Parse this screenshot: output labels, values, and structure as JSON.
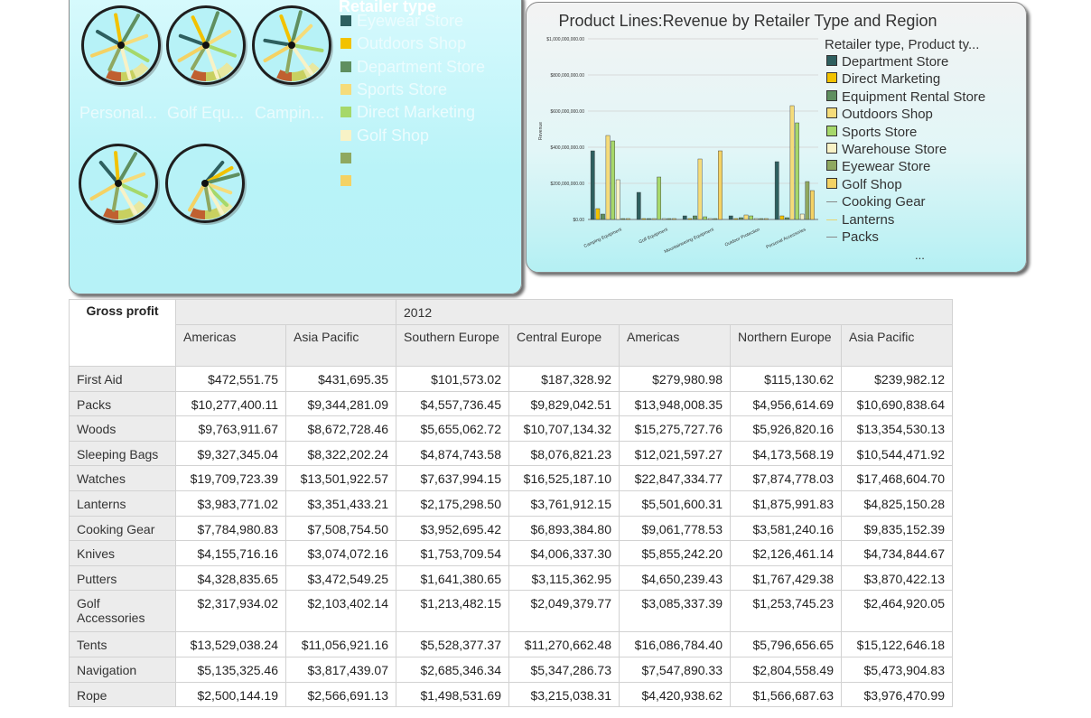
{
  "gauge_panel": {
    "legend_title": "Retailer type",
    "gauge_labels": [
      "Personal...",
      "Golf Equ...",
      "Campin..."
    ],
    "legend": [
      {
        "label": "Eyewear Store",
        "color": "#2e5f5f"
      },
      {
        "label": "Outdoors Shop",
        "color": "#f2c200"
      },
      {
        "label": "Department Store",
        "color": "#5f8f5f"
      },
      {
        "label": "Sports Store",
        "color": "#f5dc7a"
      },
      {
        "label": "Direct Marketing",
        "color": "#a6d86a"
      },
      {
        "label": "Golf Shop",
        "color": "#f8f2c6"
      },
      {
        "label": "",
        "color": "#8fa860"
      },
      {
        "label": "",
        "color": "#f4d264"
      }
    ]
  },
  "chart_data": {
    "type": "bar",
    "title": "Product Lines:Revenue by Retailer Type and Region",
    "xlabel": "",
    "ylabel": "Revenue",
    "ylim": [
      0,
      1000000000
    ],
    "y_ticks": [
      "$0.00",
      "$200,000,000.00",
      "$400,000,000.00",
      "$600,000,000.00",
      "$800,000,000.00",
      "$1,000,000,000.00"
    ],
    "categories": [
      "Camping Equipment",
      "Golf Equipment",
      "Mountaineering Equipment",
      "Outdoor Protection",
      "Personal Accessories"
    ],
    "legend_title": "Retailer type, Product ty...",
    "legend_more": "...",
    "series": [
      {
        "name": "Department Store",
        "color": "#2e5f5f",
        "values": [
          380000000,
          150000000,
          20000000,
          20000000,
          320000000
        ]
      },
      {
        "name": "Direct Marketing",
        "color": "#f2c200",
        "values": [
          60000000,
          5000000,
          5000000,
          5000000,
          20000000
        ]
      },
      {
        "name": "Equipment Rental Store",
        "color": "#5f8f5f",
        "values": [
          30000000,
          5000000,
          20000000,
          10000000,
          10000000
        ]
      },
      {
        "name": "Outdoors Shop",
        "color": "#f5dc7a",
        "values": [
          465000000,
          5000000,
          335000000,
          25000000,
          630000000
        ]
      },
      {
        "name": "Sports Store",
        "color": "#a6d86a",
        "values": [
          435000000,
          235000000,
          15000000,
          20000000,
          535000000
        ]
      },
      {
        "name": "Warehouse Store",
        "color": "#f8f2c6",
        "values": [
          220000000,
          5000000,
          5000000,
          5000000,
          30000000
        ]
      },
      {
        "name": "Eyewear Store",
        "color": "#8fa860",
        "values": [
          5000000,
          5000000,
          5000000,
          5000000,
          210000000
        ]
      },
      {
        "name": "Golf Shop",
        "color": "#f4d264",
        "values": [
          5000000,
          5000000,
          380000000,
          5000000,
          160000000
        ]
      }
    ],
    "legend_lines": [
      {
        "name": "Cooking Gear",
        "color": "#888888"
      },
      {
        "name": "Lanterns",
        "color": "#e8d470"
      },
      {
        "name": "Packs",
        "color": "#888888"
      }
    ]
  },
  "crosstab": {
    "corner": "Gross profit",
    "year": "2012",
    "regions": [
      "Americas",
      "Asia Pacific",
      "Southern Europe",
      "Central Europe",
      "Americas",
      "Northern Europe",
      "Asia Pacific"
    ],
    "rows": [
      {
        "label": "First Aid",
        "values": [
          "$472,551.75",
          "$431,695.35",
          "$101,573.02",
          "$187,328.92",
          "$279,980.98",
          "$115,130.62",
          "$239,982.12"
        ]
      },
      {
        "label": "Packs",
        "values": [
          "$10,277,400.11",
          "$9,344,281.09",
          "$4,557,736.45",
          "$9,829,042.51",
          "$13,948,008.35",
          "$4,956,614.69",
          "$10,690,838.64"
        ]
      },
      {
        "label": "Woods",
        "values": [
          "$9,763,911.67",
          "$8,672,728.46",
          "$5,655,062.72",
          "$10,707,134.32",
          "$15,275,727.76",
          "$5,926,820.16",
          "$13,354,530.13"
        ]
      },
      {
        "label": "Sleeping Bags",
        "values": [
          "$9,327,345.04",
          "$8,322,202.24",
          "$4,874,743.58",
          "$8,076,821.23",
          "$12,021,597.27",
          "$4,173,568.19",
          "$10,544,471.92"
        ]
      },
      {
        "label": "Watches",
        "values": [
          "$19,709,723.39",
          "$13,501,922.57",
          "$7,637,994.15",
          "$16,525,187.10",
          "$22,847,334.77",
          "$7,874,778.03",
          "$17,468,604.70"
        ]
      },
      {
        "label": "Lanterns",
        "values": [
          "$3,983,771.02",
          "$3,351,433.21",
          "$2,175,298.50",
          "$3,761,912.15",
          "$5,501,600.31",
          "$1,875,991.83",
          "$4,825,150.28"
        ]
      },
      {
        "label": "Cooking Gear",
        "values": [
          "$7,784,980.83",
          "$7,508,754.50",
          "$3,952,695.42",
          "$6,893,384.80",
          "$9,061,778.53",
          "$3,581,240.16",
          "$9,835,152.39"
        ]
      },
      {
        "label": "Knives",
        "values": [
          "$4,155,716.16",
          "$3,074,072.16",
          "$1,753,709.54",
          "$4,006,337.30",
          "$5,855,242.20",
          "$2,126,461.14",
          "$4,734,844.67"
        ]
      },
      {
        "label": "Putters",
        "values": [
          "$4,328,835.65",
          "$3,472,549.25",
          "$1,641,380.65",
          "$3,115,362.95",
          "$4,650,239.43",
          "$1,767,429.38",
          "$3,870,422.13"
        ]
      },
      {
        "label": "Golf Accessories",
        "values": [
          "$2,317,934.02",
          "$2,103,402.14",
          "$1,213,482.15",
          "$2,049,379.77",
          "$3,085,337.39",
          "$1,253,745.23",
          "$2,464,920.05"
        ]
      },
      {
        "label": "Tents",
        "values": [
          "$13,529,038.24",
          "$11,056,921.16",
          "$5,528,377.37",
          "$11,270,662.48",
          "$16,086,784.40",
          "$5,796,656.65",
          "$15,122,646.18"
        ]
      },
      {
        "label": "Navigation",
        "values": [
          "$5,135,325.46",
          "$3,817,439.07",
          "$2,685,346.34",
          "$5,347,286.73",
          "$7,547,890.33",
          "$2,804,558.49",
          "$5,473,904.83"
        ]
      },
      {
        "label": "Rope",
        "values": [
          "$2,500,144.19",
          "$2,566,691.13",
          "$1,498,531.69",
          "$3,215,038.31",
          "$4,420,938.62",
          "$1,566,687.63",
          "$3,976,470.99"
        ]
      }
    ]
  }
}
